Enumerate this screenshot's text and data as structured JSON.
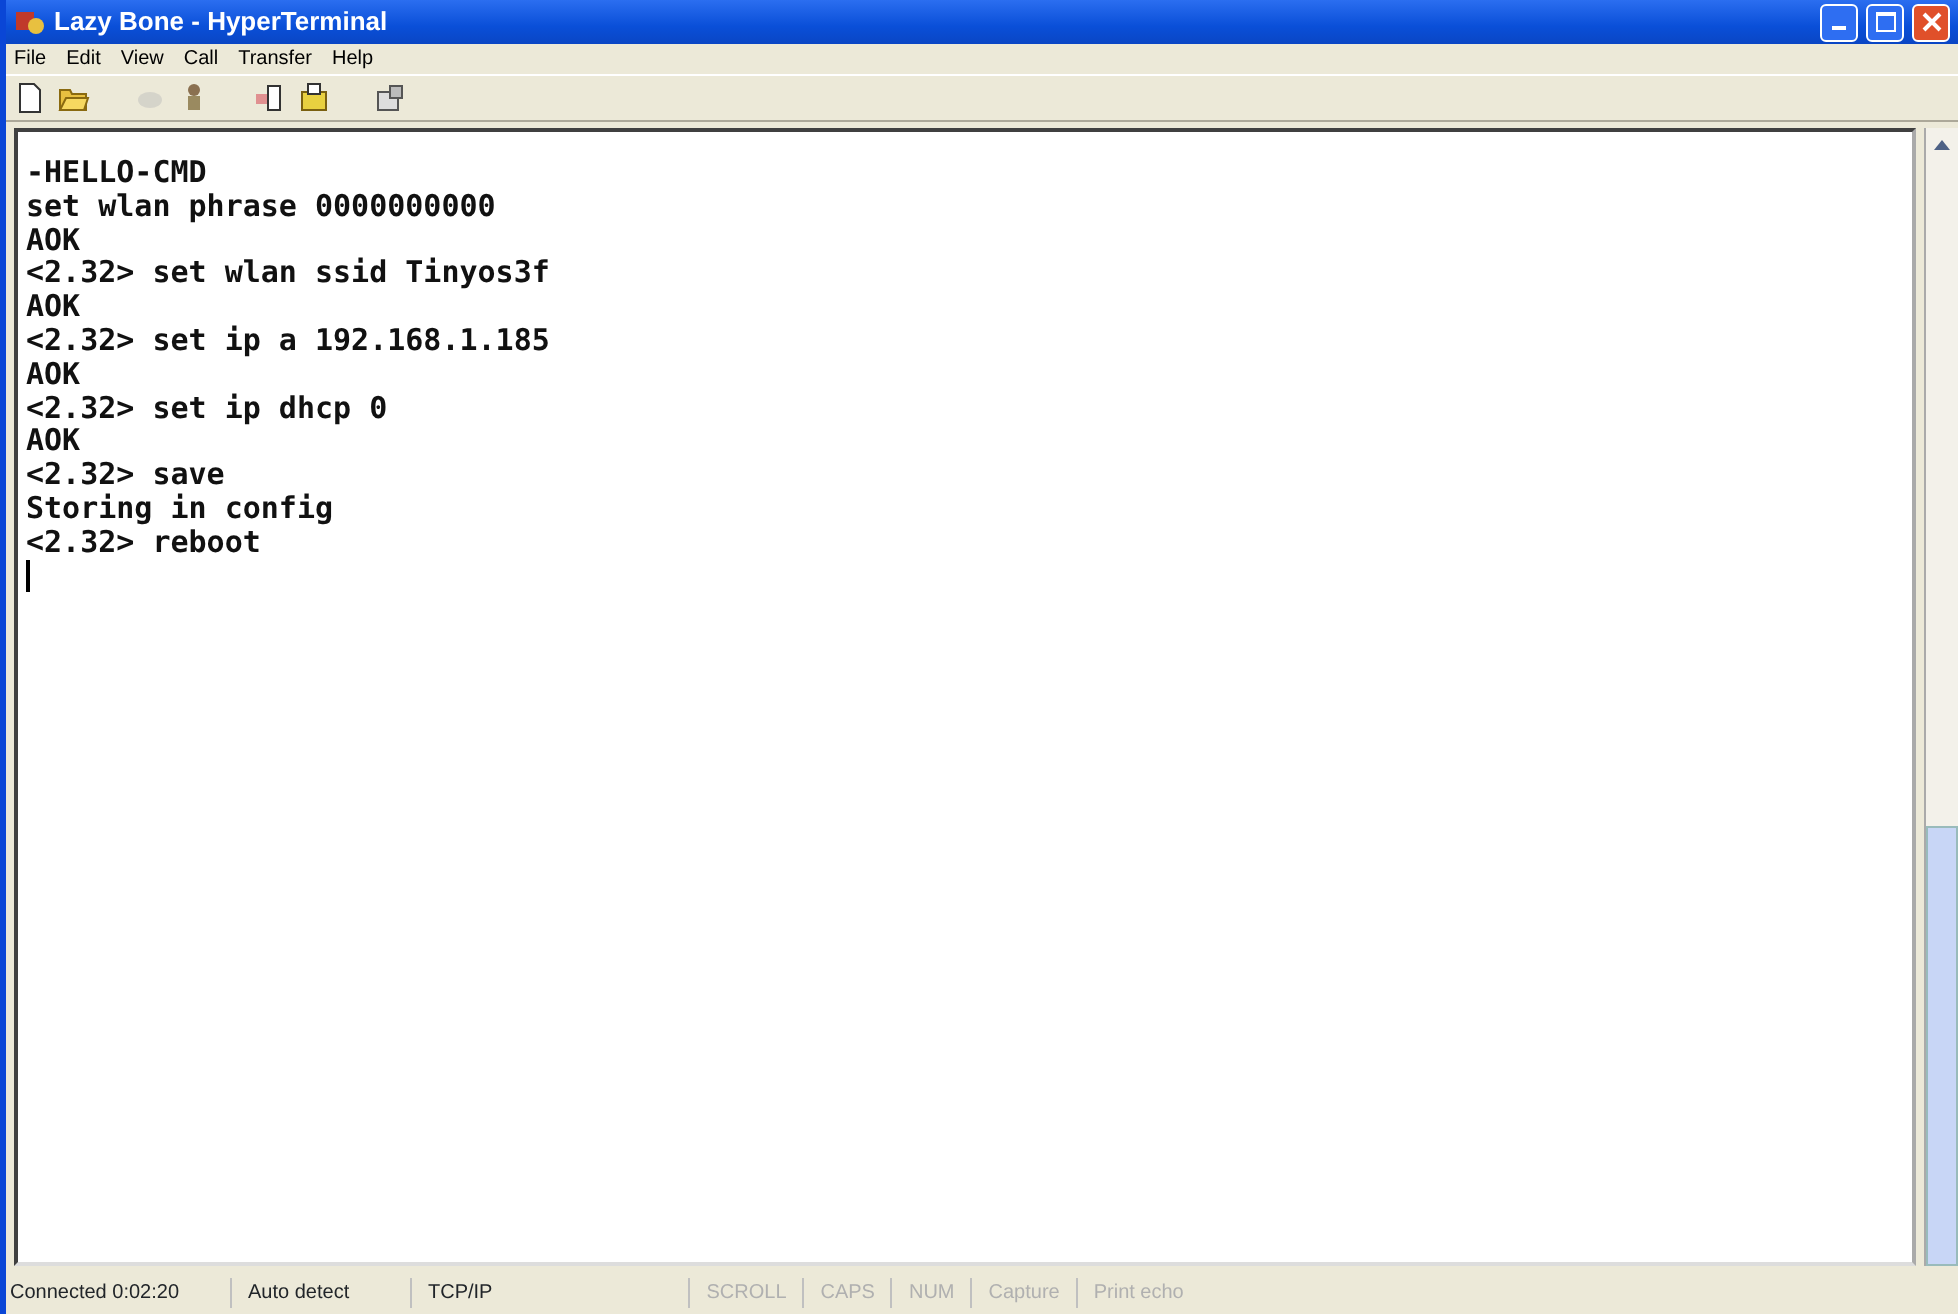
{
  "window": {
    "title": "Lazy Bone - HyperTerminal"
  },
  "menu": [
    "File",
    "Edit",
    "View",
    "Call",
    "Transfer",
    "Help"
  ],
  "toolbar": [
    {
      "kind": "new",
      "disabled": false
    },
    {
      "kind": "open",
      "disabled": false
    },
    {
      "kind": "disconnect",
      "disabled": true
    },
    {
      "kind": "call",
      "disabled": false
    },
    {
      "kind": "send",
      "disabled": false
    },
    {
      "kind": "receive",
      "disabled": false
    },
    {
      "kind": "properties",
      "disabled": false
    }
  ],
  "terminal": {
    "lines": [
      "-HELLO-CMD",
      "set wlan phrase 0000000000",
      "AOK",
      "<2.32> set wlan ssid Tinyos3f",
      "AOK",
      "<2.32> set ip a 192.168.1.185",
      "AOK",
      "<2.32> set ip dhcp 0",
      "AOK",
      "<2.32> save",
      "Storing in config",
      "<2.32> reboot"
    ]
  },
  "status_bar": [
    {
      "text": "Connected 0:02:20",
      "disabled": false
    },
    {
      "text": "Auto detect",
      "disabled": false
    },
    {
      "text": "TCP/IP",
      "disabled": false
    },
    {
      "text": "SCROLL",
      "disabled": true
    },
    {
      "text": "CAPS",
      "disabled": true
    },
    {
      "text": "NUM",
      "disabled": true
    },
    {
      "text": "Capture",
      "disabled": true
    },
    {
      "text": "Print echo",
      "disabled": true
    }
  ]
}
